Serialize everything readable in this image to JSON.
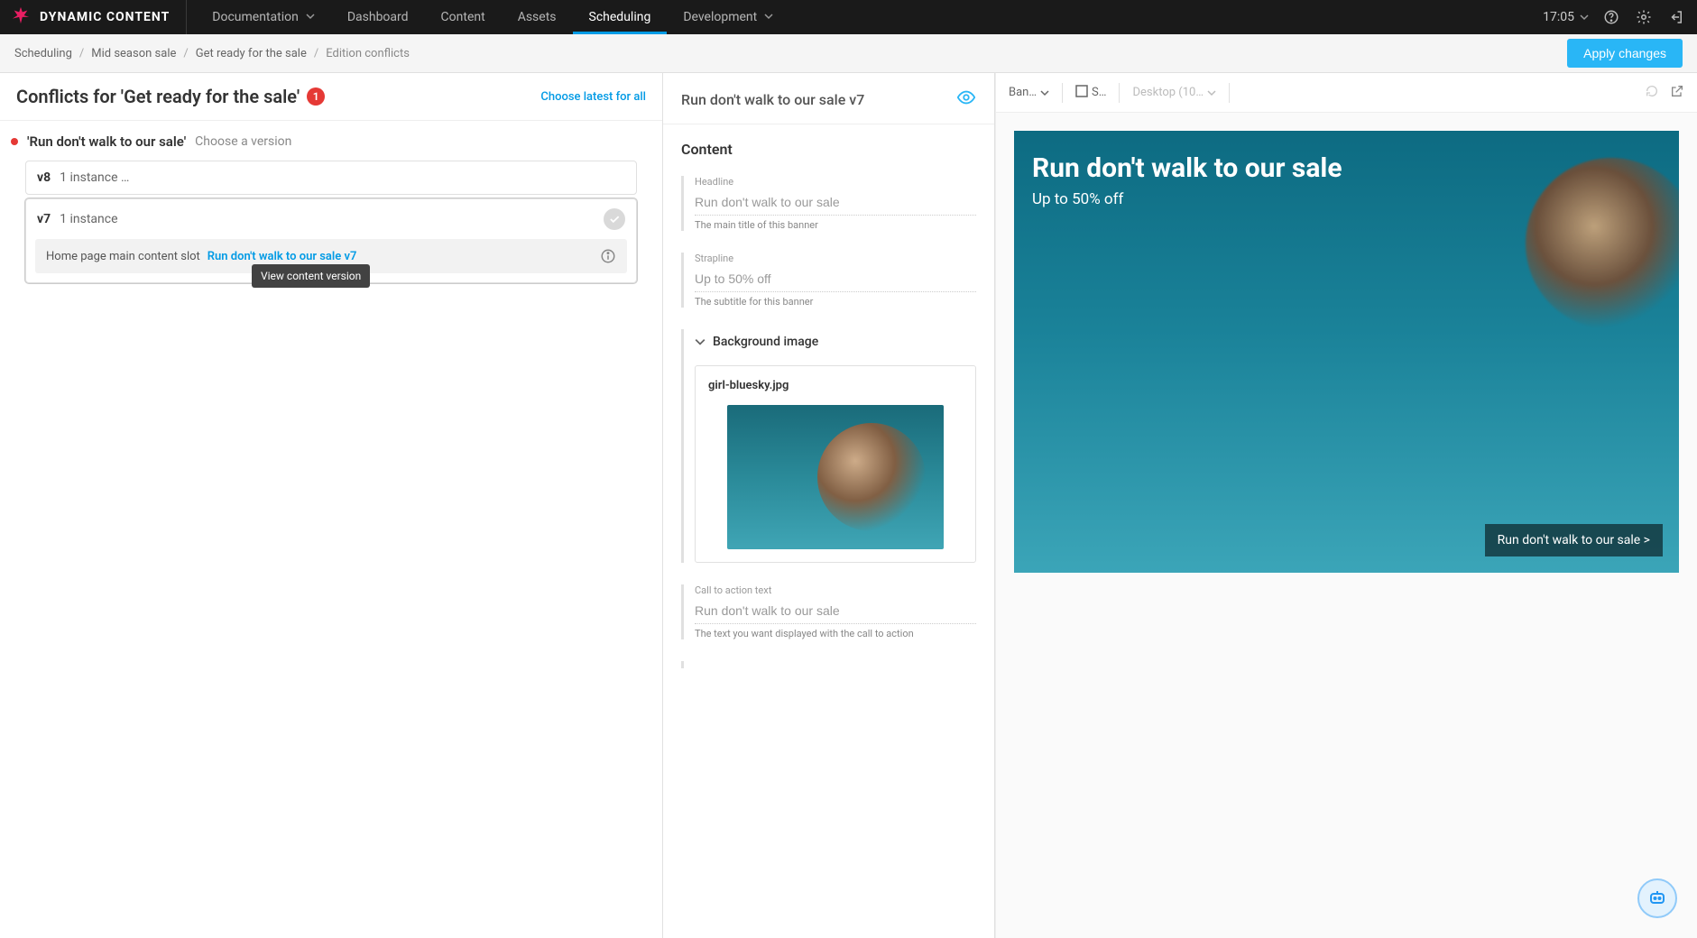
{
  "topbar": {
    "brand": "DYNAMIC CONTENT",
    "nav": {
      "documentation": "Documentation",
      "dashboard": "Dashboard",
      "content": "Content",
      "assets": "Assets",
      "scheduling": "Scheduling",
      "development": "Development"
    },
    "time": "17:05"
  },
  "subheader": {
    "crumbs": {
      "c0": "Scheduling",
      "c1": "Mid season sale",
      "c2": "Get ready for the sale",
      "c3": "Edition conflicts"
    },
    "apply": "Apply changes"
  },
  "left": {
    "title": "Conflicts for 'Get ready for the sale'",
    "badge": "1",
    "choose_all": "Choose latest for all",
    "conflict_name": "'Run don't walk to our sale'",
    "choose_version": "Choose a version",
    "versions": {
      "v8": {
        "num": "v8",
        "inst": "1 instance …"
      },
      "v7": {
        "num": "v7",
        "inst": "1 instance",
        "slot_label": "Home page main content slot",
        "slot_link": "Run don't walk to our sale v7"
      }
    },
    "tooltip": "View content version"
  },
  "mid": {
    "title": "Run don't walk to our sale v7",
    "section": "Content",
    "headline": {
      "label": "Headline",
      "value": "Run don't walk to our sale",
      "help": "The main title of this banner"
    },
    "strapline": {
      "label": "Strapline",
      "value": "Up to 50% off",
      "help": "The subtitle for this banner"
    },
    "bg": {
      "label": "Background image",
      "filename": "girl-bluesky.jpg"
    },
    "cta": {
      "label": "Call to action text",
      "value": "Run don't walk to our sale",
      "help": "The text you want displayed with the call to action"
    }
  },
  "preview": {
    "select1": "Ban…",
    "select2": "S…",
    "device": "Desktop (10…",
    "banner_title": "Run don't walk to our sale",
    "banner_sub": "Up to 50% off",
    "banner_cta": "Run don't walk to our sale >"
  }
}
